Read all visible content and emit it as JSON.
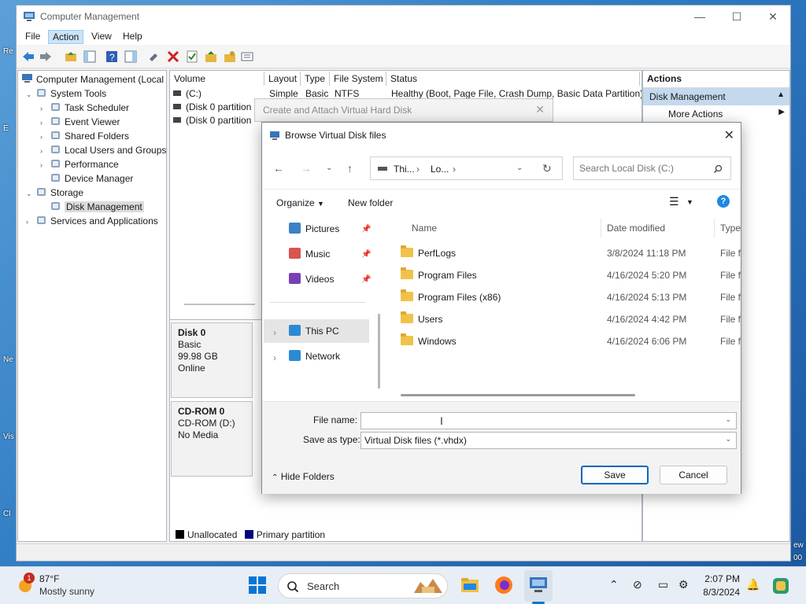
{
  "desktop_fragments": [
    "Re",
    "E",
    "Ne",
    "Vis",
    "Cl",
    "ew",
    "00"
  ],
  "window": {
    "title": "Computer Management",
    "controls": {
      "minimize": "—",
      "maximize": "☐",
      "close": "✕"
    }
  },
  "menu": [
    "File",
    "Action",
    "View",
    "Help"
  ],
  "tree": {
    "root": "Computer Management (Local",
    "items": [
      {
        "label": "System Tools",
        "chev": "⌄",
        "level": 1
      },
      {
        "label": "Task Scheduler",
        "chev": "›",
        "level": 2
      },
      {
        "label": "Event Viewer",
        "chev": "›",
        "level": 2
      },
      {
        "label": "Shared Folders",
        "chev": "›",
        "level": 2
      },
      {
        "label": "Local Users and Groups",
        "chev": "›",
        "level": 2
      },
      {
        "label": "Performance",
        "chev": "›",
        "level": 2
      },
      {
        "label": "Device Manager",
        "chev": "",
        "level": 2
      },
      {
        "label": "Storage",
        "chev": "⌄",
        "level": 1
      },
      {
        "label": "Disk Management",
        "chev": "",
        "level": 2,
        "selected": true
      },
      {
        "label": "Services and Applications",
        "chev": "›",
        "level": 1
      }
    ]
  },
  "volumes": {
    "headers": [
      "Volume",
      "Layout",
      "Type",
      "File System",
      "Status"
    ],
    "rows": [
      {
        "volume": "(C:)",
        "layout": "Simple",
        "type": "Basic",
        "fs": "NTFS",
        "status": "Healthy (Boot, Page File, Crash Dump, Basic Data Partition)"
      },
      {
        "volume": "(Disk 0 partition",
        "layout": "",
        "type": "",
        "fs": "",
        "status": ""
      },
      {
        "volume": "(Disk 0 partition",
        "layout": "",
        "type": "",
        "fs": "",
        "status": ""
      }
    ]
  },
  "disks": [
    {
      "name": "Disk 0",
      "type": "Basic",
      "size": "99.98 GB",
      "status": "Online"
    },
    {
      "name": "CD-ROM 0",
      "type": "CD-ROM (D:)",
      "size": "",
      "status": "No Media"
    }
  ],
  "legend": [
    {
      "label": "Unallocated",
      "color": "#000000"
    },
    {
      "label": "Primary partition",
      "color": "#000080"
    }
  ],
  "actions": {
    "title": "Actions",
    "section": "Disk Management",
    "more": "More Actions"
  },
  "create_dialog": {
    "title": "Create and Attach Virtual Hard Disk"
  },
  "browse_dialog": {
    "title": "Browse Virtual Disk files",
    "address": [
      "Thi...",
      "Lo...",
      "›"
    ],
    "search_placeholder": "Search Local Disk (C:)",
    "organize": "Organize",
    "new_folder": "New folder",
    "nav": [
      {
        "label": "Pictures",
        "icon": "pictures-icon",
        "color": "#3b82c4"
      },
      {
        "label": "Music",
        "icon": "music-icon",
        "color": "#d9534f"
      },
      {
        "label": "Videos",
        "icon": "videos-icon",
        "color": "#7b3fb5"
      },
      {
        "label": "This PC",
        "icon": "pc-icon",
        "color": "#2c8ad4"
      },
      {
        "label": "Network",
        "icon": "network-icon",
        "color": "#2c8ad4"
      }
    ],
    "columns": [
      "Name",
      "Date modified",
      "Type"
    ],
    "files": [
      {
        "name": "PerfLogs",
        "date": "3/8/2024 11:18 PM",
        "type": "File fo"
      },
      {
        "name": "Program Files",
        "date": "4/16/2024 5:20 PM",
        "type": "File fo"
      },
      {
        "name": "Program Files (x86)",
        "date": "4/16/2024 5:13 PM",
        "type": "File fo"
      },
      {
        "name": "Users",
        "date": "4/16/2024 4:42 PM",
        "type": "File fo"
      },
      {
        "name": "Windows",
        "date": "4/16/2024 6:06 PM",
        "type": "File fo"
      }
    ],
    "file_name_label": "File name:",
    "file_name_value": "",
    "save_type_label": "Save as type:",
    "save_type_value": "Virtual Disk files (*.vhdx)",
    "hide_folders": "Hide Folders",
    "save": "Save",
    "cancel": "Cancel"
  },
  "taskbar": {
    "weather_temp": "87°F",
    "weather_desc": "Mostly sunny",
    "weather_badge": "1",
    "search": "Search",
    "time": "2:07 PM",
    "date": "8/3/2024"
  }
}
